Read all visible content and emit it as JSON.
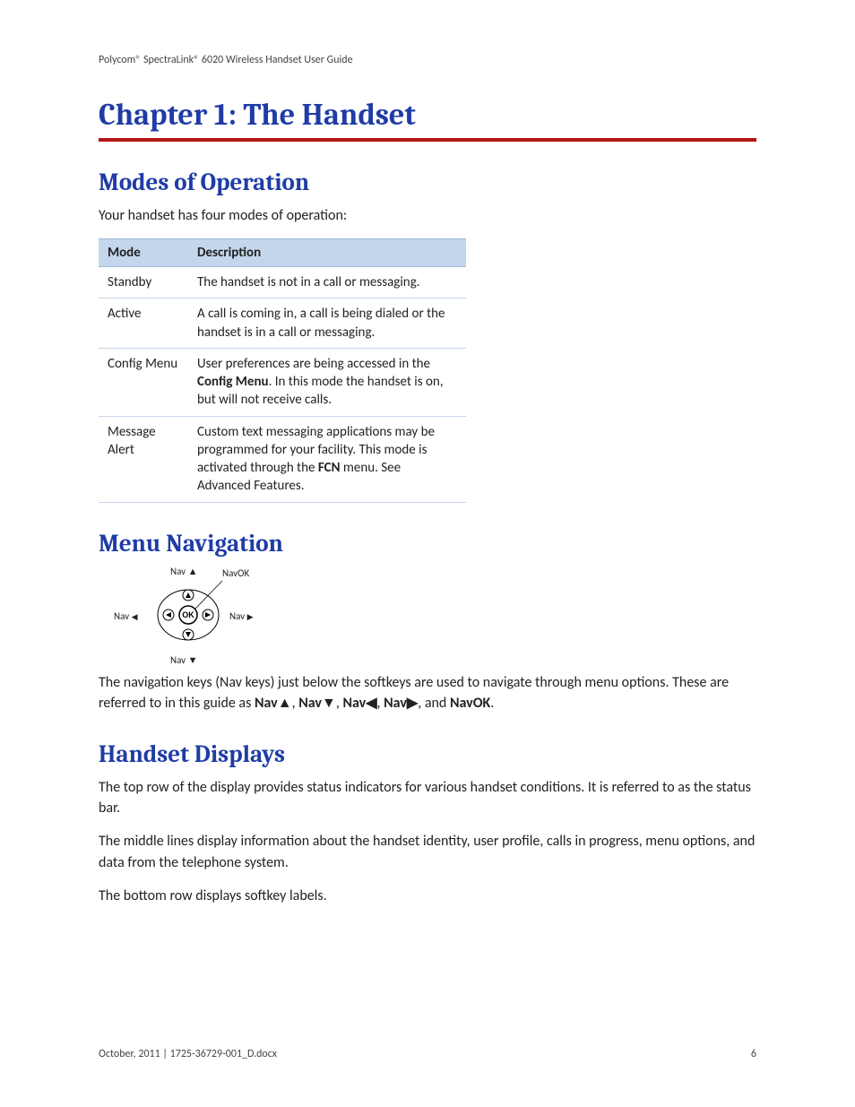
{
  "doc_header": "Polycom® SpectraLink® 6020 Wireless Handset User Guide",
  "chapter_title": "Chapter 1:  The Handset",
  "sec_modes": {
    "title": "Modes of Operation",
    "intro": "Your handset has four modes of operation:",
    "headers": {
      "mode": "Mode",
      "desc": "Description"
    },
    "rows": [
      {
        "mode": "Standby",
        "desc_pre": "The handset is not in a call or messaging.",
        "bold": "",
        "desc_post": ""
      },
      {
        "mode": "Active",
        "desc_pre": "A call is coming in, a call is being dialed or the handset is in a call or messaging.",
        "bold": "",
        "desc_post": ""
      },
      {
        "mode": "Config Menu",
        "desc_pre": "User preferences are being accessed in the ",
        "bold": "Config Menu",
        "desc_post": ". In this mode the handset is on, but will not receive calls."
      },
      {
        "mode": "Message Alert",
        "desc_pre": "Custom text messaging applications may be programmed for your facility. This mode is activated through the ",
        "bold": "FCN",
        "desc_post": " menu. See Advanced Features."
      }
    ]
  },
  "sec_nav": {
    "title": "Menu Navigation",
    "labels": {
      "up": "Nav ▲",
      "ok": "NavOK",
      "left_pre": "Nav ",
      "left_tri": "◀",
      "right_pre": "Nav ",
      "right_tri": "▶",
      "down": "Nav ▼",
      "ok_btn": "OK"
    },
    "para_pre": "The navigation keys (Nav keys) just below the softkeys are used to navigate through menu options. These are referred to in this guide as ",
    "k1": "Nav▲",
    "s1": ", ",
    "k2": "Nav▼",
    "s2": ", ",
    "k3": "Nav◀",
    "s3": ", ",
    "k4": "Nav▶",
    "s4": ", and ",
    "k5": "NavOK",
    "para_post": "."
  },
  "sec_disp": {
    "title": "Handset Displays",
    "p1": "The top row of the display provides status indicators for various handset conditions. It is referred to as the status bar.",
    "p2": "The middle lines display information about the handset identity, user profile, calls in progress, menu options, and data from the telephone system.",
    "p3": "The bottom row displays softkey labels."
  },
  "footer": {
    "left": "October, 2011   |   1725-36729-001_D.docx",
    "page": "6"
  }
}
